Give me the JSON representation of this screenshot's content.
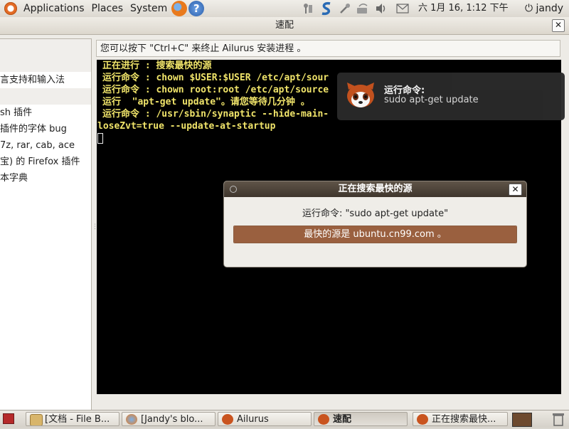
{
  "top_panel": {
    "menus": [
      "Applications",
      "Places",
      "System"
    ],
    "clock": "六 1月 16,  1:12 下午",
    "user": "jandy"
  },
  "window": {
    "title": "速配",
    "close_glyph": "✕",
    "left_items": [
      "",
      "",
      "言支持和输入法",
      "",
      "sh 插件",
      "插件的字体 bug",
      "7z, rar, cab, ace",
      "宝) 的 Firefox 插件",
      "本字典"
    ],
    "hint": "您可以按下 \"Ctrl+C\" 来终止 Ailurus 安装进程 。",
    "terminal_lines": [
      "正在进行 : 搜索最快的源",
      "运行命令 : chown $USER:$USER /etc/apt/sour",
      "运行命令 : chown root:root /etc/apt/source",
      "运行  \"apt-get update\"。请您等待几分钟 。",
      "运行命令 : /usr/sbin/synaptic --hide-main-",
      "loseZvt=true --update-at-startup"
    ]
  },
  "notification": {
    "title": "运行命令:",
    "body": "sudo apt-get update"
  },
  "dialog": {
    "title": "正在搜索最快的源",
    "close_glyph": "✕",
    "message": "运行命令: \"sudo apt-get update\"",
    "progress_text": "最快的源是 ubuntu.cn99.com 。",
    "progress_fraction": 1.0
  },
  "taskbar": {
    "tasks": [
      "[文档 - File B...",
      "[Jandy's blo...",
      "Ailurus",
      "速配",
      "正在搜索最快..."
    ]
  },
  "icons": {
    "help": "?",
    "power": "⏻"
  },
  "colors": {
    "terminal_text": "#f0e46a",
    "terminal_bg": "#000000",
    "progress_fill": "#9a603f",
    "dialog_title_bg": "#4e443a"
  }
}
